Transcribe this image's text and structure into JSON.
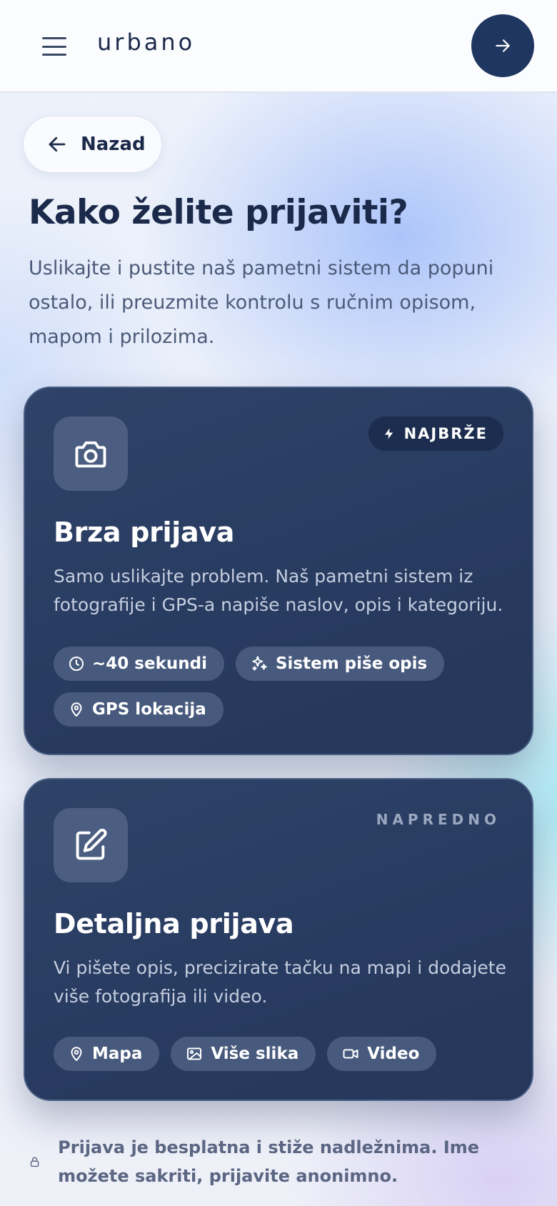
{
  "header": {
    "logo": "urbano"
  },
  "back": {
    "label": "Nazad"
  },
  "page": {
    "title": "Kako želite prijaviti?",
    "description": "Uslikajte i pustite naš pametni sistem da popuni ostalo, ili preuzmite kontrolu s ručnim opisom, mapom i prilozima."
  },
  "cards": [
    {
      "badge": "NAJBRŽE",
      "title": "Brza prijava",
      "description": "Samo uslikajte problem. Naš pametni sistem iz fotografije i GPS-a napiše naslov, opis i kategoriju.",
      "chips": [
        {
          "icon": "clock-icon",
          "label": "~40 sekundi"
        },
        {
          "icon": "sparkles-icon",
          "label": "Sistem piše opis"
        },
        {
          "icon": "map-pin-icon",
          "label": "GPS lokacija"
        }
      ]
    },
    {
      "badge": "NAPREDNO",
      "title": "Detaljna prijava",
      "description": "Vi pišete opis, precizirate tačku na mapi i dodajete više fotografija ili video.",
      "chips": [
        {
          "icon": "map-pin-icon",
          "label": "Mapa"
        },
        {
          "icon": "image-icon",
          "label": "Više slika"
        },
        {
          "icon": "video-icon",
          "label": "Video"
        }
      ]
    }
  ],
  "footer": {
    "note": "Prijava je besplatna i stiže nadležnima. Ime možete sakriti, prijavite anonimno."
  },
  "colors": {
    "primary": "#1f3760",
    "card": "#2b3f64",
    "chip": "#475a7d",
    "text": "#1b2a4a"
  }
}
